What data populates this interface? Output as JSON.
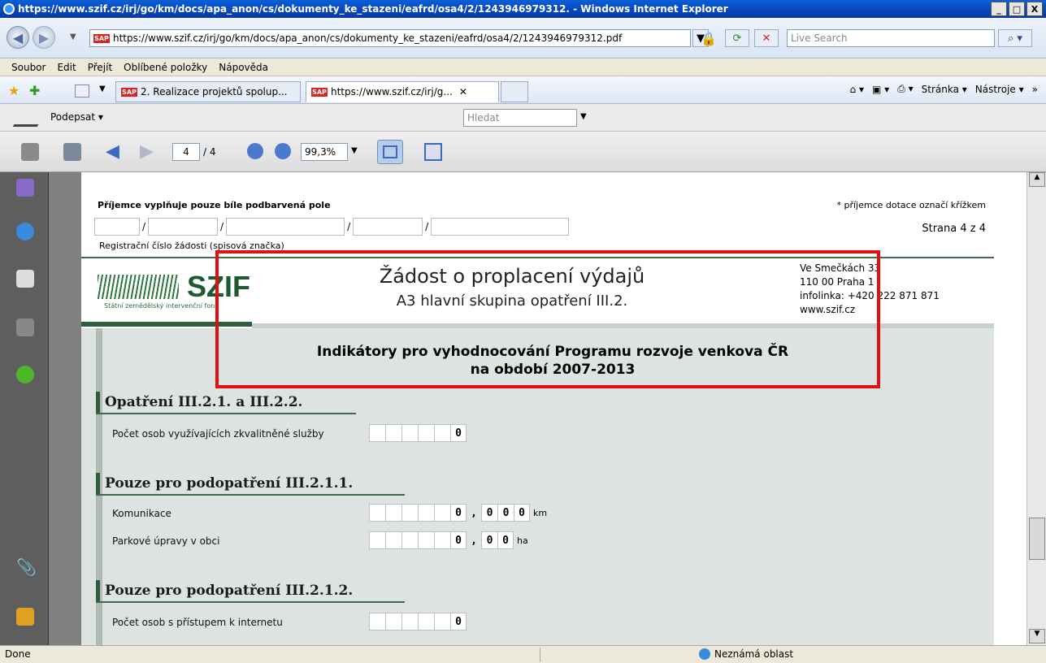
{
  "window": {
    "title": "https://www.szif.cz/irj/go/km/docs/apa_anon/cs/dokumenty_ke_stazeni/eafrd/osa4/2/1243946979312. - Windows Internet Explorer",
    "minimize": "_",
    "maximize": "□",
    "close": "X"
  },
  "address": {
    "url": "https://www.szif.cz/irj/go/km/docs/apa_anon/cs/dokumenty_ke_stazeni/eafrd/osa4/2/1243946979312.pdf",
    "search_placeholder": "Live Search"
  },
  "menu": [
    "Soubor",
    "Edit",
    "Přejít",
    "Oblíbené položky",
    "Nápověda"
  ],
  "tabs": [
    {
      "label": "2. Realizace projektů spolup..."
    },
    {
      "label": "https://www.szif.cz/irj/g..."
    }
  ],
  "commands": {
    "page": "Stránka",
    "tools": "Nástroje"
  },
  "pdf_toolbar": {
    "sign": "Podepsat",
    "find_placeholder": "Hledat",
    "current_page": "4",
    "total_pages": "/ 4",
    "zoom": "99,3%"
  },
  "form": {
    "fill_note": "Příjemce vyplňuje pouze bíle podbarvená pole",
    "cross_note": "* příjemce dotace označí křížkem",
    "page_label": "Strana 4 z 4",
    "reg_label": "Registrační číslo žádosti (spisová značka)",
    "logo_text": "SZIF",
    "logo_sub": "Státní zemědělský intervenční fond",
    "title": "Žádost o proplacení výdajů",
    "subtitle": "A3 hlavní skupina opatření III.2.",
    "address": [
      "Ve Smečkách 33",
      "110 00 Praha 1",
      "infolinka: +420 222 871 871",
      "www.szif.cz"
    ],
    "indicator_title_1": "Indikátory pro vyhodnocování Programu rozvoje venkova ČR",
    "indicator_title_2": "na období 2007-2013",
    "sections": [
      {
        "heading": "Opatření III.2.1. a III.2.2.",
        "fields": [
          {
            "label": "Počet osob využívajících zkvalitněné služby",
            "value": "0",
            "unit": ""
          }
        ]
      },
      {
        "heading": "Pouze pro podopatření III.2.1.1.",
        "fields": [
          {
            "label": "Komunikace",
            "int": "0",
            "sep": ",",
            "dec": [
              "0",
              "0",
              "0"
            ],
            "unit": "km"
          },
          {
            "label": "Parkové úpravy v obci",
            "int": "0",
            "sep": ",",
            "dec": [
              "0",
              "0"
            ],
            "unit": "ha"
          }
        ]
      },
      {
        "heading": "Pouze pro podopatření III.2.1.2.",
        "fields": [
          {
            "label": "Počet osob s přístupem k internetu",
            "value": "0",
            "unit": ""
          }
        ]
      }
    ]
  },
  "status": {
    "left": "Done",
    "zone": "Neznámá oblast"
  }
}
